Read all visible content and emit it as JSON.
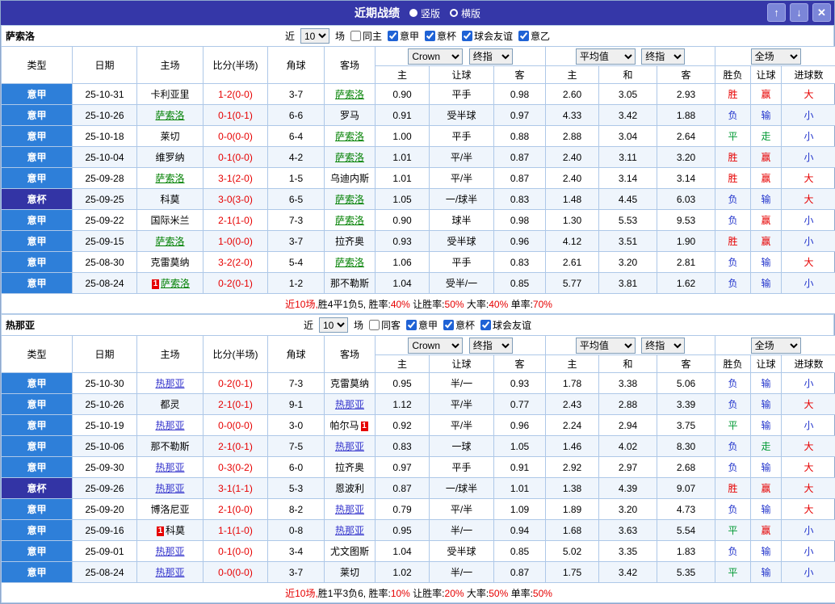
{
  "titlebar": {
    "title": "近期战绩",
    "vertical_label": "竖版",
    "horizontal_label": "横版",
    "up_icon": "↑",
    "down_icon": "↓",
    "close_icon": "✕"
  },
  "table_header": {
    "fixed_cols": [
      "类型",
      "日期",
      "主场",
      "比分(半场)",
      "角球",
      "客场"
    ],
    "sub_cols": [
      "主",
      "让球",
      "客",
      "主",
      "和",
      "客",
      "胜负",
      "让球",
      "进球数"
    ],
    "odds_select": "Crown",
    "final_select": "终指",
    "avg_select": "平均值",
    "final_select2": "终指",
    "scope_select": "全场"
  },
  "color_map": {
    "胜": "#e60000",
    "赢": "#e60000",
    "大": "#e60000",
    "平": "#009933",
    "走": "#009933",
    "负": "#2335cc",
    "输": "#2335cc",
    "小": "#2335cc"
  },
  "sections": [
    {
      "team": "萨索洛",
      "focus_color": "#008000",
      "filter": {
        "prefix": "近",
        "count": "10",
        "suffix": "场",
        "options": [
          {
            "label": "同主",
            "checked": false
          },
          {
            "label": "意甲",
            "checked": true
          },
          {
            "label": "意杯",
            "checked": true
          },
          {
            "label": "球会友谊",
            "checked": true
          },
          {
            "label": "意乙",
            "checked": true
          }
        ]
      },
      "rows": [
        {
          "league": "意甲",
          "cup": false,
          "date": "25-10-31",
          "home": {
            "name": "卡利亚里"
          },
          "score": "1-2(0-0)",
          "corners": "3-7",
          "away": {
            "name": "萨索洛",
            "focus": true
          },
          "odds": [
            "0.90",
            "平手",
            "0.98"
          ],
          "avg": [
            "2.60",
            "3.05",
            "2.93"
          ],
          "results": [
            "胜",
            "赢",
            "大"
          ]
        },
        {
          "league": "意甲",
          "cup": false,
          "date": "25-10-26",
          "home": {
            "name": "萨索洛",
            "focus": true
          },
          "score": "0-1(0-1)",
          "corners": "6-6",
          "away": {
            "name": "罗马"
          },
          "odds": [
            "0.91",
            "受半球",
            "0.97"
          ],
          "avg": [
            "4.33",
            "3.42",
            "1.88"
          ],
          "results": [
            "负",
            "输",
            "小"
          ]
        },
        {
          "league": "意甲",
          "cup": false,
          "date": "25-10-18",
          "home": {
            "name": "莱切"
          },
          "score": "0-0(0-0)",
          "corners": "6-4",
          "away": {
            "name": "萨索洛",
            "focus": true
          },
          "odds": [
            "1.00",
            "平手",
            "0.88"
          ],
          "avg": [
            "2.88",
            "3.04",
            "2.64"
          ],
          "results": [
            "平",
            "走",
            "小"
          ]
        },
        {
          "league": "意甲",
          "cup": false,
          "date": "25-10-04",
          "home": {
            "name": "维罗纳"
          },
          "score": "0-1(0-0)",
          "corners": "4-2",
          "away": {
            "name": "萨索洛",
            "focus": true
          },
          "odds": [
            "1.01",
            "平/半",
            "0.87"
          ],
          "avg": [
            "2.40",
            "3.11",
            "3.20"
          ],
          "results": [
            "胜",
            "赢",
            "小"
          ]
        },
        {
          "league": "意甲",
          "cup": false,
          "date": "25-09-28",
          "home": {
            "name": "萨索洛",
            "focus": true
          },
          "score": "3-1(2-0)",
          "corners": "1-5",
          "away": {
            "name": "乌迪内斯"
          },
          "odds": [
            "1.01",
            "平/半",
            "0.87"
          ],
          "avg": [
            "2.40",
            "3.14",
            "3.14"
          ],
          "results": [
            "胜",
            "赢",
            "大"
          ]
        },
        {
          "league": "意杯",
          "cup": true,
          "date": "25-09-25",
          "home": {
            "name": "科莫"
          },
          "score": "3-0(3-0)",
          "corners": "6-5",
          "away": {
            "name": "萨索洛",
            "focus": true
          },
          "odds": [
            "1.05",
            "一/球半",
            "0.83"
          ],
          "avg": [
            "1.48",
            "4.45",
            "6.03"
          ],
          "results": [
            "负",
            "输",
            "大"
          ]
        },
        {
          "league": "意甲",
          "cup": false,
          "date": "25-09-22",
          "home": {
            "name": "国际米兰"
          },
          "score": "2-1(1-0)",
          "corners": "7-3",
          "away": {
            "name": "萨索洛",
            "focus": true
          },
          "odds": [
            "0.90",
            "球半",
            "0.98"
          ],
          "avg": [
            "1.30",
            "5.53",
            "9.53"
          ],
          "results": [
            "负",
            "赢",
            "小"
          ]
        },
        {
          "league": "意甲",
          "cup": false,
          "date": "25-09-15",
          "home": {
            "name": "萨索洛",
            "focus": true
          },
          "score": "1-0(0-0)",
          "corners": "3-7",
          "away": {
            "name": "拉齐奥"
          },
          "odds": [
            "0.93",
            "受半球",
            "0.96"
          ],
          "avg": [
            "4.12",
            "3.51",
            "1.90"
          ],
          "results": [
            "胜",
            "赢",
            "小"
          ]
        },
        {
          "league": "意甲",
          "cup": false,
          "date": "25-08-30",
          "home": {
            "name": "克雷莫纳"
          },
          "score": "3-2(2-0)",
          "corners": "5-4",
          "away": {
            "name": "萨索洛",
            "focus": true
          },
          "odds": [
            "1.06",
            "平手",
            "0.83"
          ],
          "avg": [
            "2.61",
            "3.20",
            "2.81"
          ],
          "results": [
            "负",
            "输",
            "大"
          ]
        },
        {
          "league": "意甲",
          "cup": false,
          "date": "25-08-24",
          "home": {
            "name": "萨索洛",
            "focus": true,
            "card_pre": "1"
          },
          "score": "0-2(0-1)",
          "corners": "1-2",
          "away": {
            "name": "那不勒斯"
          },
          "odds": [
            "1.04",
            "受半/一",
            "0.85"
          ],
          "avg": [
            "5.77",
            "3.81",
            "1.62"
          ],
          "results": [
            "负",
            "输",
            "小"
          ]
        }
      ],
      "summary": [
        {
          "text": "近10场,",
          "red": true
        },
        {
          "text": "胜4平1负5, 胜率:",
          "red": false
        },
        {
          "text": "40%",
          "red": true
        },
        {
          "text": " 让胜率:",
          "red": false
        },
        {
          "text": "50%",
          "red": true
        },
        {
          "text": " 大率:",
          "red": false
        },
        {
          "text": "40%",
          "red": true
        },
        {
          "text": " 单率:",
          "red": false
        },
        {
          "text": "70%",
          "red": true
        }
      ]
    },
    {
      "team": "热那亚",
      "focus_color": "#3333cc",
      "filter": {
        "prefix": "近",
        "count": "10",
        "suffix": "场",
        "options": [
          {
            "label": "同客",
            "checked": false
          },
          {
            "label": "意甲",
            "checked": true
          },
          {
            "label": "意杯",
            "checked": true
          },
          {
            "label": "球会友谊",
            "checked": true
          }
        ]
      },
      "rows": [
        {
          "league": "意甲",
          "cup": false,
          "date": "25-10-30",
          "home": {
            "name": "热那亚",
            "focus": true
          },
          "score": "0-2(0-1)",
          "corners": "7-3",
          "away": {
            "name": "克雷莫纳"
          },
          "odds": [
            "0.95",
            "半/一",
            "0.93"
          ],
          "avg": [
            "1.78",
            "3.38",
            "5.06"
          ],
          "results": [
            "负",
            "输",
            "小"
          ]
        },
        {
          "league": "意甲",
          "cup": false,
          "date": "25-10-26",
          "home": {
            "name": "都灵"
          },
          "score": "2-1(0-1)",
          "corners": "9-1",
          "away": {
            "name": "热那亚",
            "focus": true
          },
          "odds": [
            "1.12",
            "平/半",
            "0.77"
          ],
          "avg": [
            "2.43",
            "2.88",
            "3.39"
          ],
          "results": [
            "负",
            "输",
            "大"
          ]
        },
        {
          "league": "意甲",
          "cup": false,
          "date": "25-10-19",
          "home": {
            "name": "热那亚",
            "focus": true
          },
          "score": "0-0(0-0)",
          "corners": "3-0",
          "away": {
            "name": "帕尔马",
            "card_post": "1"
          },
          "odds": [
            "0.92",
            "平/半",
            "0.96"
          ],
          "avg": [
            "2.24",
            "2.94",
            "3.75"
          ],
          "results": [
            "平",
            "输",
            "小"
          ]
        },
        {
          "league": "意甲",
          "cup": false,
          "date": "25-10-06",
          "home": {
            "name": "那不勒斯"
          },
          "score": "2-1(0-1)",
          "corners": "7-5",
          "away": {
            "name": "热那亚",
            "focus": true
          },
          "odds": [
            "0.83",
            "一球",
            "1.05"
          ],
          "avg": [
            "1.46",
            "4.02",
            "8.30"
          ],
          "results": [
            "负",
            "走",
            "大"
          ]
        },
        {
          "league": "意甲",
          "cup": false,
          "date": "25-09-30",
          "home": {
            "name": "热那亚",
            "focus": true
          },
          "score": "0-3(0-2)",
          "corners": "6-0",
          "away": {
            "name": "拉齐奥"
          },
          "odds": [
            "0.97",
            "平手",
            "0.91"
          ],
          "avg": [
            "2.92",
            "2.97",
            "2.68"
          ],
          "results": [
            "负",
            "输",
            "大"
          ]
        },
        {
          "league": "意杯",
          "cup": true,
          "date": "25-09-26",
          "home": {
            "name": "热那亚",
            "focus": true
          },
          "score": "3-1(1-1)",
          "corners": "5-3",
          "away": {
            "name": "恩波利"
          },
          "odds": [
            "0.87",
            "一/球半",
            "1.01"
          ],
          "avg": [
            "1.38",
            "4.39",
            "9.07"
          ],
          "results": [
            "胜",
            "赢",
            "大"
          ]
        },
        {
          "league": "意甲",
          "cup": false,
          "date": "25-09-20",
          "home": {
            "name": "博洛尼亚"
          },
          "score": "2-1(0-0)",
          "corners": "8-2",
          "away": {
            "name": "热那亚",
            "focus": true
          },
          "odds": [
            "0.79",
            "平/半",
            "1.09"
          ],
          "avg": [
            "1.89",
            "3.20",
            "4.73"
          ],
          "results": [
            "负",
            "输",
            "大"
          ]
        },
        {
          "league": "意甲",
          "cup": false,
          "date": "25-09-16",
          "home": {
            "name": "科莫",
            "card_pre": "1"
          },
          "score": "1-1(1-0)",
          "corners": "0-8",
          "away": {
            "name": "热那亚",
            "focus": true
          },
          "odds": [
            "0.95",
            "半/一",
            "0.94"
          ],
          "avg": [
            "1.68",
            "3.63",
            "5.54"
          ],
          "results": [
            "平",
            "赢",
            "小"
          ]
        },
        {
          "league": "意甲",
          "cup": false,
          "date": "25-09-01",
          "home": {
            "name": "热那亚",
            "focus": true
          },
          "score": "0-1(0-0)",
          "corners": "3-4",
          "away": {
            "name": "尤文图斯"
          },
          "odds": [
            "1.04",
            "受半球",
            "0.85"
          ],
          "avg": [
            "5.02",
            "3.35",
            "1.83"
          ],
          "results": [
            "负",
            "输",
            "小"
          ]
        },
        {
          "league": "意甲",
          "cup": false,
          "date": "25-08-24",
          "home": {
            "name": "热那亚",
            "focus": true
          },
          "score": "0-0(0-0)",
          "corners": "3-7",
          "away": {
            "name": "莱切"
          },
          "odds": [
            "1.02",
            "半/一",
            "0.87"
          ],
          "avg": [
            "1.75",
            "3.42",
            "5.35"
          ],
          "results": [
            "平",
            "输",
            "小"
          ]
        }
      ],
      "summary": [
        {
          "text": "近10场,",
          "red": true
        },
        {
          "text": "胜1平3负6, 胜率:",
          "red": false
        },
        {
          "text": "10%",
          "red": true
        },
        {
          "text": " 让胜率:",
          "red": false
        },
        {
          "text": "20%",
          "red": true
        },
        {
          "text": " 大率:",
          "red": false
        },
        {
          "text": "50%",
          "red": true
        },
        {
          "text": " 单率:",
          "red": false
        },
        {
          "text": "50%",
          "red": true
        }
      ]
    }
  ]
}
